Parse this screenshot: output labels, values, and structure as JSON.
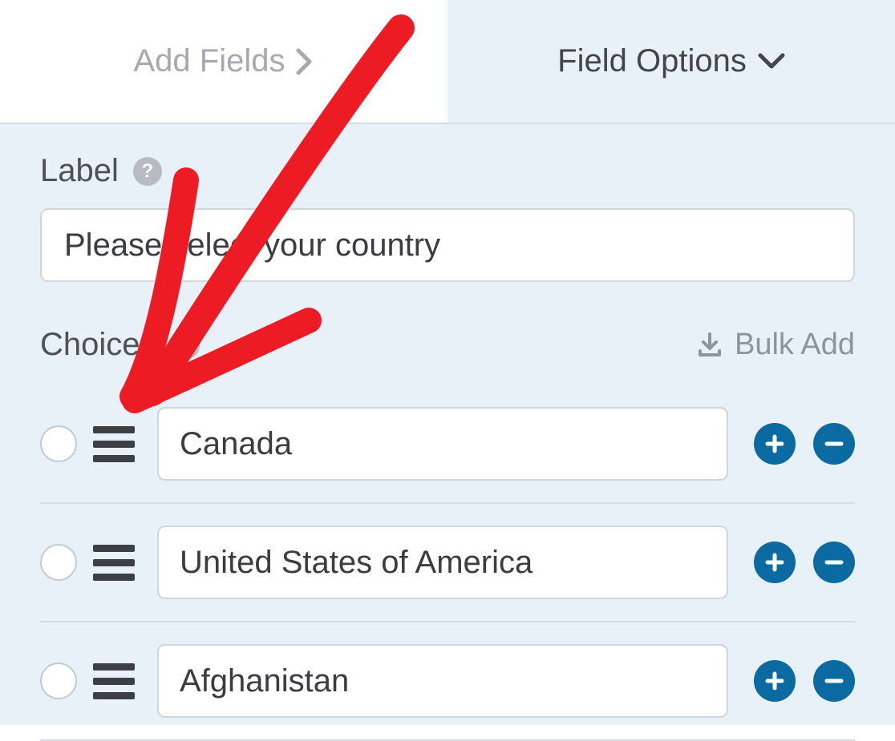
{
  "tabs": {
    "add_fields": "Add Fields",
    "field_options": "Field Options"
  },
  "label_section": {
    "title": "Label",
    "value": "Please select your country"
  },
  "choices_section": {
    "title": "Choices",
    "bulk_add": "Bulk Add",
    "items": [
      {
        "value": "Canada"
      },
      {
        "value": "United States of America"
      },
      {
        "value": "Afghanistan"
      }
    ]
  }
}
